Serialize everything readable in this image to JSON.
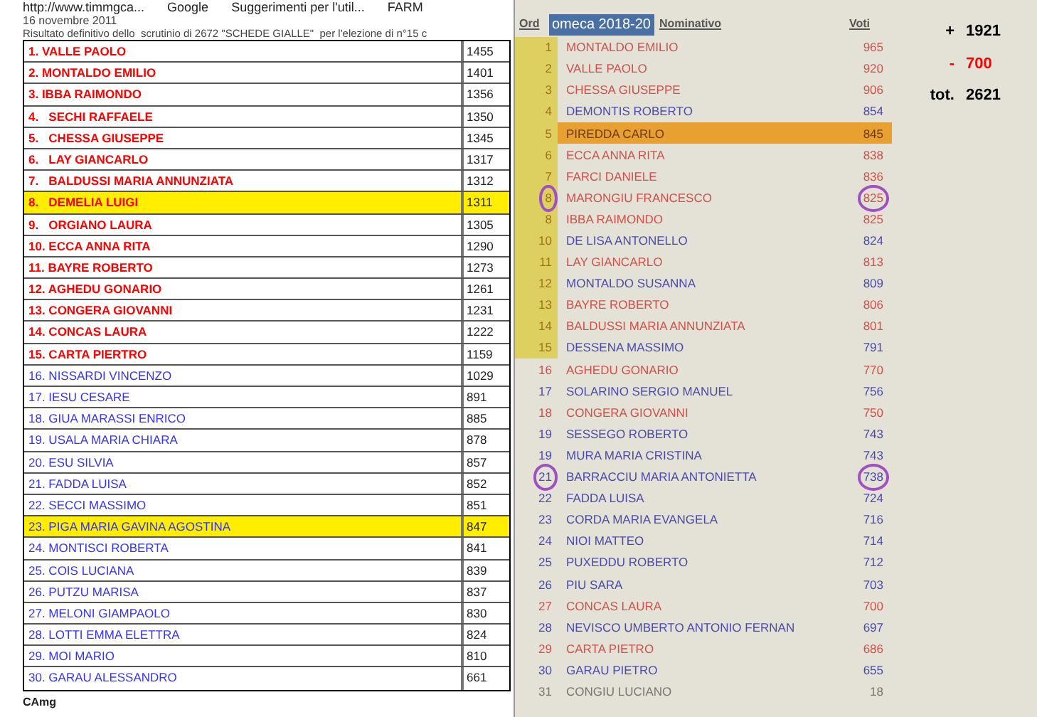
{
  "bookmarks": [
    {
      "label": "http://www.timmgca..."
    },
    {
      "label": "Google"
    },
    {
      "label": "Suggerimenti per l'util..."
    },
    {
      "label": "FARM"
    }
  ],
  "left": {
    "date": "16 novembre 2011",
    "subtitle": "Risultato definitivo dello  scrutinio di 2672 \"SCHEDE GIALLE\"  per l'elezione di n°15 c",
    "rows": [
      {
        "name": "1. VALLE PAOLO",
        "votes": "1455",
        "color": "#ff0000",
        "highlighted": false
      },
      {
        "name": "2. MONTALDO EMILIO",
        "votes": "1401",
        "color": "#ff0000",
        "highlighted": false
      },
      {
        "name": "3. IBBA RAIMONDO",
        "votes": "1356",
        "color": "#ff0000",
        "highlighted": false
      },
      {
        "name": "4.   SECHI RAFFAELE",
        "votes": "1350",
        "color": "#ff0000",
        "highlighted": false
      },
      {
        "name": "5.   CHESSA GIUSEPPE",
        "votes": "1345",
        "color": "#ff0000",
        "highlighted": false
      },
      {
        "name": "6.   LAY GIANCARLO",
        "votes": "1317",
        "color": "#ff0000",
        "highlighted": false
      },
      {
        "name": "7.   BALDUSSI MARIA ANNUNZIATA",
        "votes": "1312",
        "color": "#ff0000",
        "highlighted": false
      },
      {
        "name": "8.   DEMELIA LUIGI",
        "votes": "1311",
        "color": "#ff0000",
        "highlighted": true
      },
      {
        "name": "9.   ORGIANO LAURA",
        "votes": "1305",
        "color": "#ff0000",
        "highlighted": false
      },
      {
        "name": "10. ECCA ANNA RITA",
        "votes": "1290",
        "color": "#ff0000",
        "highlighted": false
      },
      {
        "name": "11. BAYRE ROBERTO",
        "votes": "1273",
        "color": "#ff0000",
        "highlighted": false
      },
      {
        "name": "12. AGHEDU GONARIO",
        "votes": "1261",
        "color": "#ff0000",
        "highlighted": false
      },
      {
        "name": "13. CONGERA GIOVANNI",
        "votes": "1231",
        "color": "#ff0000",
        "highlighted": false
      },
      {
        "name": "14. CONCAS LAURA",
        "votes": "1222",
        "color": "#ff0000",
        "highlighted": false
      },
      {
        "name": "15. CARTA PIERTRO",
        "votes": "1159",
        "color": "#ff0000",
        "highlighted": false
      },
      {
        "name": "16. NISSARDI VINCENZO",
        "votes": "1029",
        "color": "#3333ff",
        "highlighted": false
      },
      {
        "name": "17. IESU CESARE",
        "votes": "891",
        "color": "#3333ff",
        "highlighted": false
      },
      {
        "name": "18. GIUA MARASSI ENRICO",
        "votes": "885",
        "color": "#3333ff",
        "highlighted": false
      },
      {
        "name": "19. USALA MARIA CHIARA",
        "votes": "878",
        "color": "#3333ff",
        "highlighted": false
      },
      {
        "name": "20. ESU SILVIA",
        "votes": "857",
        "color": "#3333ff",
        "highlighted": false
      },
      {
        "name": "21. FADDA LUISA",
        "votes": "852",
        "color": "#3333ff",
        "highlighted": false
      },
      {
        "name": "22. SECCI MASSIMO",
        "votes": "851",
        "color": "#3333ff",
        "highlighted": false
      },
      {
        "name": "23. PIGA MARIA GAVINA AGOSTINA",
        "votes": "847",
        "color": "#3333ff",
        "highlighted": true
      },
      {
        "name": "24. MONTISCI ROBERTA",
        "votes": "841",
        "color": "#3333ff",
        "highlighted": false
      },
      {
        "name": "25. COIS LUCIANA",
        "votes": "839",
        "color": "#3333ff",
        "highlighted": false
      },
      {
        "name": "26. PUTZU MARISA",
        "votes": "837",
        "color": "#3333ff",
        "highlighted": false
      },
      {
        "name": "27. MELONI GIAMPAOLO",
        "votes": "830",
        "color": "#3333ff",
        "highlighted": false
      },
      {
        "name": "28. LOTTI EMMA ELETTRA",
        "votes": "824",
        "color": "#3333ff",
        "highlighted": false
      },
      {
        "name": "29. MOI MARIO",
        "votes": "810",
        "color": "#3333ff",
        "highlighted": false
      },
      {
        "name": "30. GARAU ALESSANDRO",
        "votes": "661",
        "color": "#3333ff",
        "highlighted": false
      }
    ],
    "footer": "CAmg"
  },
  "right": {
    "columns": [
      "Ord",
      "Nominativo",
      "Voti"
    ],
    "overlay_title": "omeca 2018-20",
    "rows": [
      {
        "ord": "1",
        "name": "MONTALDO EMILIO",
        "votes": "965",
        "color": "#d0504a",
        "elected": true,
        "selected": false,
        "circled": false
      },
      {
        "ord": "2",
        "name": "VALLE PAOLO",
        "votes": "920",
        "color": "#d0504a",
        "elected": true,
        "selected": false,
        "circled": false
      },
      {
        "ord": "3",
        "name": "CHESSA GIUSEPPE",
        "votes": "906",
        "color": "#d0504a",
        "elected": true,
        "selected": false,
        "circled": false
      },
      {
        "ord": "4",
        "name": "DEMONTIS ROBERTO",
        "votes": "854",
        "color": "#4a4ab0",
        "elected": true,
        "selected": false,
        "circled": false
      },
      {
        "ord": "5",
        "name": "PIREDDA CARLO",
        "votes": "845",
        "color": "#6b3a10",
        "elected": true,
        "selected": true,
        "circled": false
      },
      {
        "ord": "6",
        "name": "ECCA ANNA RITA",
        "votes": "838",
        "color": "#d0504a",
        "elected": true,
        "selected": false,
        "circled": false
      },
      {
        "ord": "7",
        "name": "FARCI DANIELE",
        "votes": "836",
        "color": "#d0504a",
        "elected": true,
        "selected": false,
        "circled": false
      },
      {
        "ord": "8",
        "name": "MARONGIU FRANCESCO",
        "votes": "825",
        "color": "#d0504a",
        "elected": true,
        "selected": false,
        "circled": true
      },
      {
        "ord": "8",
        "name": "IBBA RAIMONDO",
        "votes": "825",
        "color": "#d0504a",
        "elected": true,
        "selected": false,
        "circled": false
      },
      {
        "ord": "10",
        "name": "DE LISA ANTONELLO",
        "votes": "824",
        "color": "#4a4ab0",
        "elected": true,
        "selected": false,
        "circled": false
      },
      {
        "ord": "11",
        "name": "LAY GIANCARLO",
        "votes": "813",
        "color": "#d0504a",
        "elected": true,
        "selected": false,
        "circled": false
      },
      {
        "ord": "12",
        "name": "MONTALDO SUSANNA",
        "votes": "809",
        "color": "#4a4ab0",
        "elected": true,
        "selected": false,
        "circled": false
      },
      {
        "ord": "13",
        "name": "BAYRE ROBERTO",
        "votes": "806",
        "color": "#d0504a",
        "elected": true,
        "selected": false,
        "circled": false
      },
      {
        "ord": "14",
        "name": "BALDUSSI MARIA ANNUNZIATA",
        "votes": "801",
        "color": "#d0504a",
        "elected": true,
        "selected": false,
        "circled": false
      },
      {
        "ord": "15",
        "name": "DESSENA MASSIMO",
        "votes": "791",
        "color": "#4a4ab0",
        "elected": true,
        "selected": false,
        "circled": false
      },
      {
        "ord": "16",
        "name": "AGHEDU GONARIO",
        "votes": "770",
        "color": "#d0504a",
        "elected": false,
        "selected": false,
        "circled": false
      },
      {
        "ord": "17",
        "name": "SOLARINO SERGIO MANUEL",
        "votes": "756",
        "color": "#4a4ab0",
        "elected": false,
        "selected": false,
        "circled": false
      },
      {
        "ord": "18",
        "name": "CONGERA GIOVANNI",
        "votes": "750",
        "color": "#d0504a",
        "elected": false,
        "selected": false,
        "circled": false
      },
      {
        "ord": "19",
        "name": "SESSEGO ROBERTO",
        "votes": "743",
        "color": "#4a4ab0",
        "elected": false,
        "selected": false,
        "circled": false
      },
      {
        "ord": "19",
        "name": "MURA MARIA CRISTINA",
        "votes": "743",
        "color": "#4a4ab0",
        "elected": false,
        "selected": false,
        "circled": false
      },
      {
        "ord": "21",
        "name": "BARRACCIU MARIA ANTONIETTA",
        "votes": "738",
        "color": "#4a4ab0",
        "elected": false,
        "selected": false,
        "circled": true
      },
      {
        "ord": "22",
        "name": "FADDA LUISA",
        "votes": "724",
        "color": "#4a4ab0",
        "elected": false,
        "selected": false,
        "circled": false
      },
      {
        "ord": "23",
        "name": "CORDA MARIA EVANGELA",
        "votes": "716",
        "color": "#4a4ab0",
        "elected": false,
        "selected": false,
        "circled": false
      },
      {
        "ord": "24",
        "name": "NIOI MATTEO",
        "votes": "714",
        "color": "#4a4ab0",
        "elected": false,
        "selected": false,
        "circled": false
      },
      {
        "ord": "25",
        "name": "PUXEDDU ROBERTO",
        "votes": "712",
        "color": "#4a4ab0",
        "elected": false,
        "selected": false,
        "circled": false
      },
      {
        "ord": "26",
        "name": "PIU SARA",
        "votes": "703",
        "color": "#4a4ab0",
        "elected": false,
        "selected": false,
        "circled": false
      },
      {
        "ord": "27",
        "name": "CONCAS LAURA",
        "votes": "700",
        "color": "#d0504a",
        "elected": false,
        "selected": false,
        "circled": false
      },
      {
        "ord": "28",
        "name": "NEVISCO UMBERTO ANTONIO FERNAN",
        "votes": "697",
        "color": "#4a4ab0",
        "elected": false,
        "selected": false,
        "circled": false
      },
      {
        "ord": "29",
        "name": "CARTA PIETRO",
        "votes": "686",
        "color": "#d0504a",
        "elected": false,
        "selected": false,
        "circled": false
      },
      {
        "ord": "30",
        "name": "GARAU PIETRO",
        "votes": "655",
        "color": "#4a4ab0",
        "elected": false,
        "selected": false,
        "circled": false
      },
      {
        "ord": "31",
        "name": "CONGIU LUCIANO",
        "votes": "18",
        "color": "#777777",
        "elected": false,
        "selected": false,
        "circled": false
      }
    ],
    "totals": [
      {
        "sign": "+",
        "value": "1921",
        "kind": "plus"
      },
      {
        "sign": "-",
        "value": "700",
        "kind": "minus"
      },
      {
        "sign": "tot.",
        "value": "2621",
        "kind": "total"
      }
    ]
  }
}
